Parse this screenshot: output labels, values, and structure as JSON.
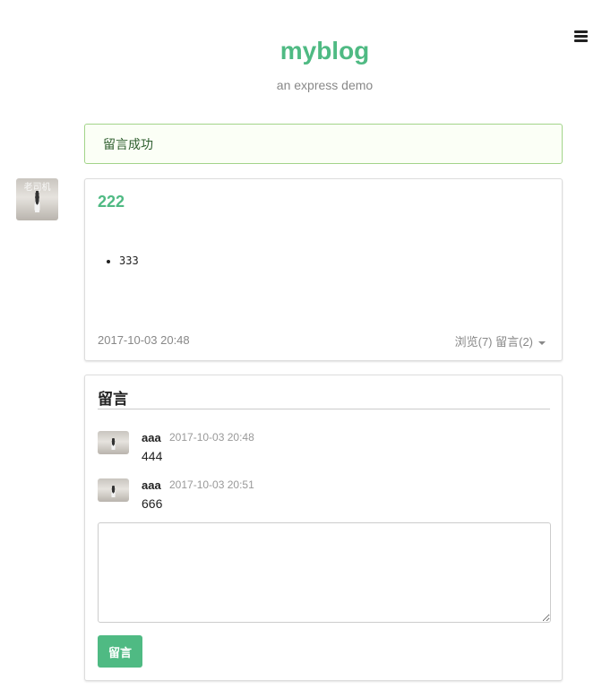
{
  "header": {
    "site_title": "myblog",
    "subtitle": "an express demo",
    "menu_icon": "hamburger-icon"
  },
  "flash": {
    "message": "留言成功"
  },
  "post": {
    "author_avatar_caption": "老司机",
    "title": "222",
    "content_items": [
      "333"
    ],
    "date": "2017-10-03 20:48",
    "meta": "浏览(7) 留言(2)"
  },
  "comments": {
    "header": "留言",
    "items": [
      {
        "author": "aaa",
        "time": "2017-10-03 20:48",
        "text": "444"
      },
      {
        "author": "aaa",
        "time": "2017-10-03 20:51",
        "text": "666"
      }
    ],
    "input_placeholder": "",
    "submit_label": "留言"
  },
  "colors": {
    "accent": "#4fba83",
    "flash_border": "#a3d48a",
    "flash_bg": "#fbfff6"
  }
}
